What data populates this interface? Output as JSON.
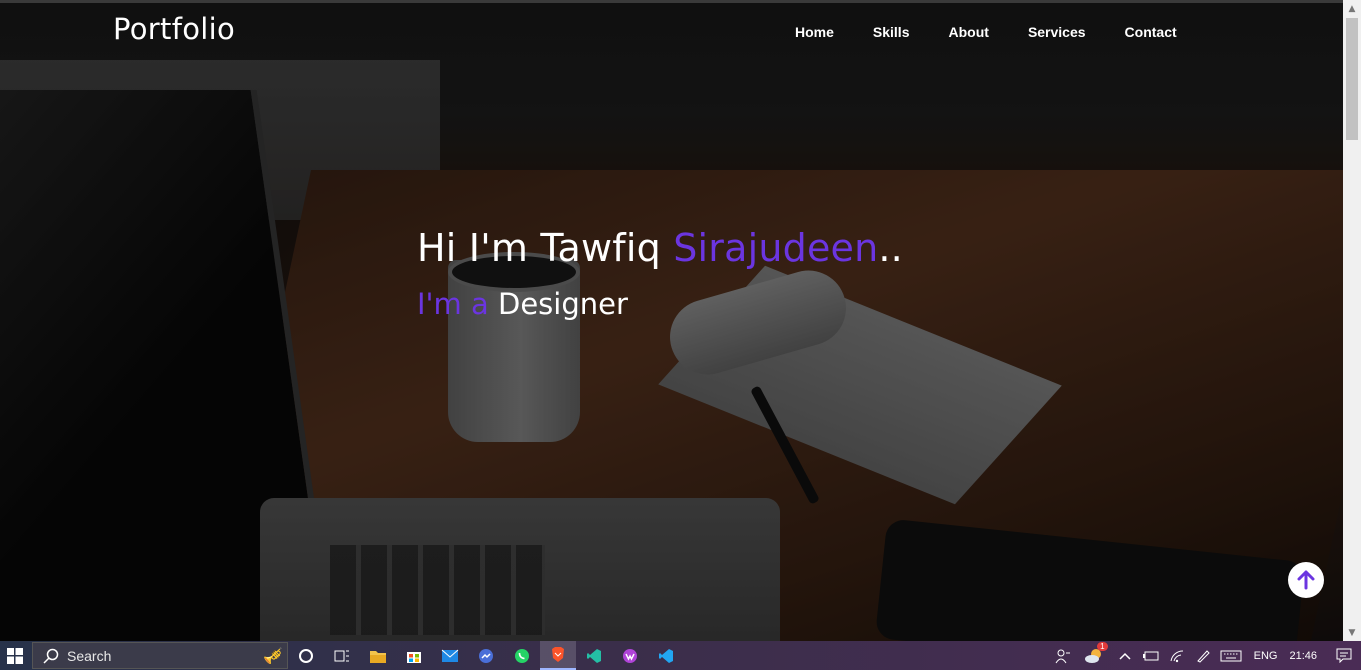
{
  "header": {
    "logo": "Portfolio",
    "nav": [
      "Home",
      "Skills",
      "About",
      "Services",
      "Contact"
    ]
  },
  "hero": {
    "greeting_prefix": "Hi I'm Tawfiq ",
    "greeting_accent": "Sirajudeen",
    "greeting_suffix": "..",
    "role_accent": "I'm a",
    "role_text": "Designer"
  },
  "back_to_top": {
    "icon": "arrow-up-icon"
  },
  "colors": {
    "accent": "#6b35e0",
    "text": "#ffffff"
  },
  "taskbar": {
    "search_placeholder": "Search",
    "apps": [
      "cortana-icon",
      "task-view-icon",
      "file-explorer-icon",
      "store-icon",
      "mail-icon",
      "messenger-icon",
      "whatsapp-icon",
      "brave-icon",
      "vscode-insiders-icon",
      "app-icon",
      "vscode-icon"
    ],
    "language": "ENG",
    "time": "21:46",
    "notification_badge": "1"
  }
}
